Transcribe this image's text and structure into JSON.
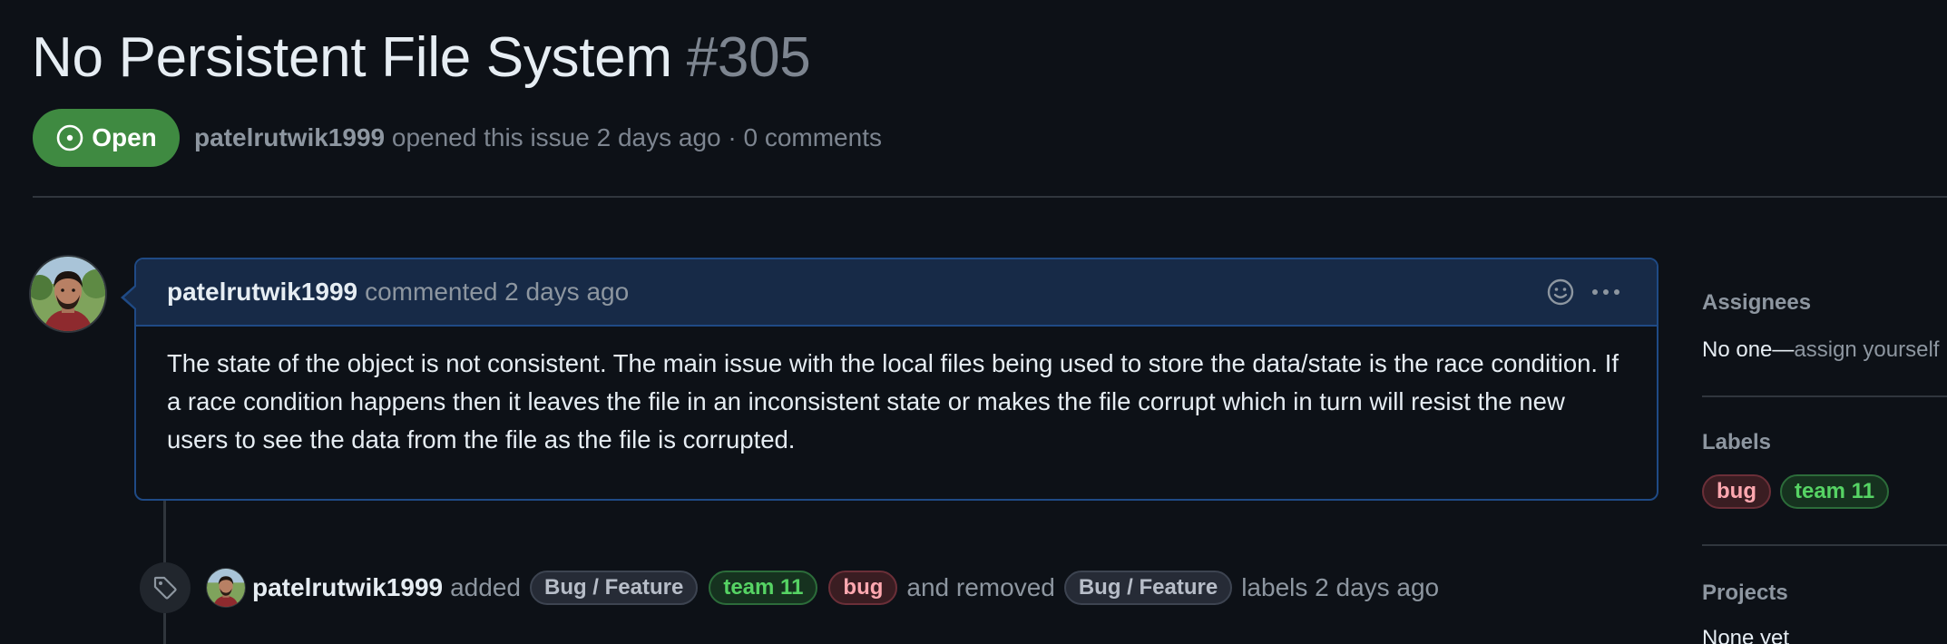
{
  "issue": {
    "title": "No Persistent File System",
    "number": "#305",
    "state": "Open",
    "author": "patelrutwik1999",
    "meta_text": "opened this issue 2 days ago · 0 comments"
  },
  "comment": {
    "author": "patelrutwik1999",
    "meta": "commented 2 days ago",
    "body": "The state of the object is not consistent. The main issue with the local files being used to store the data/state is the race condition. If a race condition happens then it leaves the file in an inconsistent state or makes the file corrupt which in turn will resist the new users to see the data from the file as the file is corrupted."
  },
  "event": {
    "author": "patelrutwik1999",
    "added_text": "added",
    "added_labels": [
      "Bug / Feature",
      "team 11",
      "bug"
    ],
    "removed_text": "and removed",
    "removed_labels": [
      "Bug / Feature"
    ],
    "suffix": "labels 2 days ago"
  },
  "sidebar": {
    "assignees_heading": "Assignees",
    "assignees_value": "No one—",
    "assignees_link": "assign yourself",
    "labels_heading": "Labels",
    "labels": [
      "bug",
      "team 11"
    ],
    "projects_heading": "Projects",
    "projects_value": "None yet"
  },
  "colors": {
    "background": "#0d1117",
    "open_badge": "#3f8a41",
    "comment_border": "#1f4a85",
    "comment_header": "#172a47",
    "label_bug": "#ffa8b0",
    "label_team": "#56d364"
  },
  "icons": [
    "issue-open-icon",
    "smiley-icon",
    "kebab-horizontal-icon",
    "tag-icon"
  ]
}
